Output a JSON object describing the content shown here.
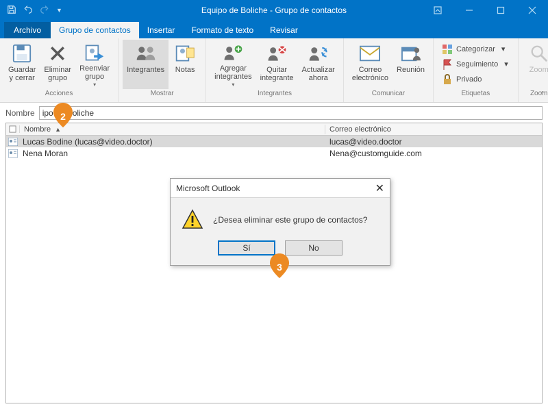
{
  "title": "Equipo de Boliche - Grupo de contactos",
  "tabs": {
    "file": "Archivo",
    "contactGroup": "Grupo de contactos",
    "insert": "Insertar",
    "format": "Formato de texto",
    "review": "Revisar"
  },
  "ribbon": {
    "groups": {
      "actions": {
        "label": "Acciones",
        "saveClose": "Guardar\ny cerrar",
        "deleteGroup": "Eliminar\ngrupo",
        "forwardGroup": "Reenviar\ngrupo"
      },
      "show": {
        "label": "Mostrar",
        "members": "Integrantes",
        "notes": "Notas"
      },
      "members": {
        "label": "Integrantes",
        "add": "Agregar\nintegrantes",
        "remove": "Quitar\nintegrante",
        "update": "Actualizar\nahora"
      },
      "communicate": {
        "label": "Comunicar",
        "email": "Correo\nelectrónico",
        "meeting": "Reunión"
      },
      "tags": {
        "label": "Etiquetas",
        "categorize": "Categorizar",
        "followup": "Seguimiento",
        "private": "Privado"
      },
      "zoom": {
        "label": "Zoom",
        "zoom": "Zoom"
      }
    }
  },
  "nameRow": {
    "label": "Nombre",
    "value": "ipo de Boliche"
  },
  "list": {
    "headers": {
      "name": "Nombre",
      "email": "Correo electrónico"
    },
    "rows": [
      {
        "name": "Lucas Bodine (lucas@video.doctor)",
        "email": "lucas@video.doctor",
        "selected": true
      },
      {
        "name": "Nena Moran",
        "email": "Nena@customguide.com",
        "selected": false
      }
    ]
  },
  "dialog": {
    "title": "Microsoft Outlook",
    "message": "¿Desea eliminar este grupo de contactos?",
    "yes": "Sí",
    "no": "No"
  },
  "callouts": {
    "two": "2",
    "three": "3"
  },
  "colors": {
    "accent": "#0173c7",
    "callout": "#ec8a23"
  }
}
